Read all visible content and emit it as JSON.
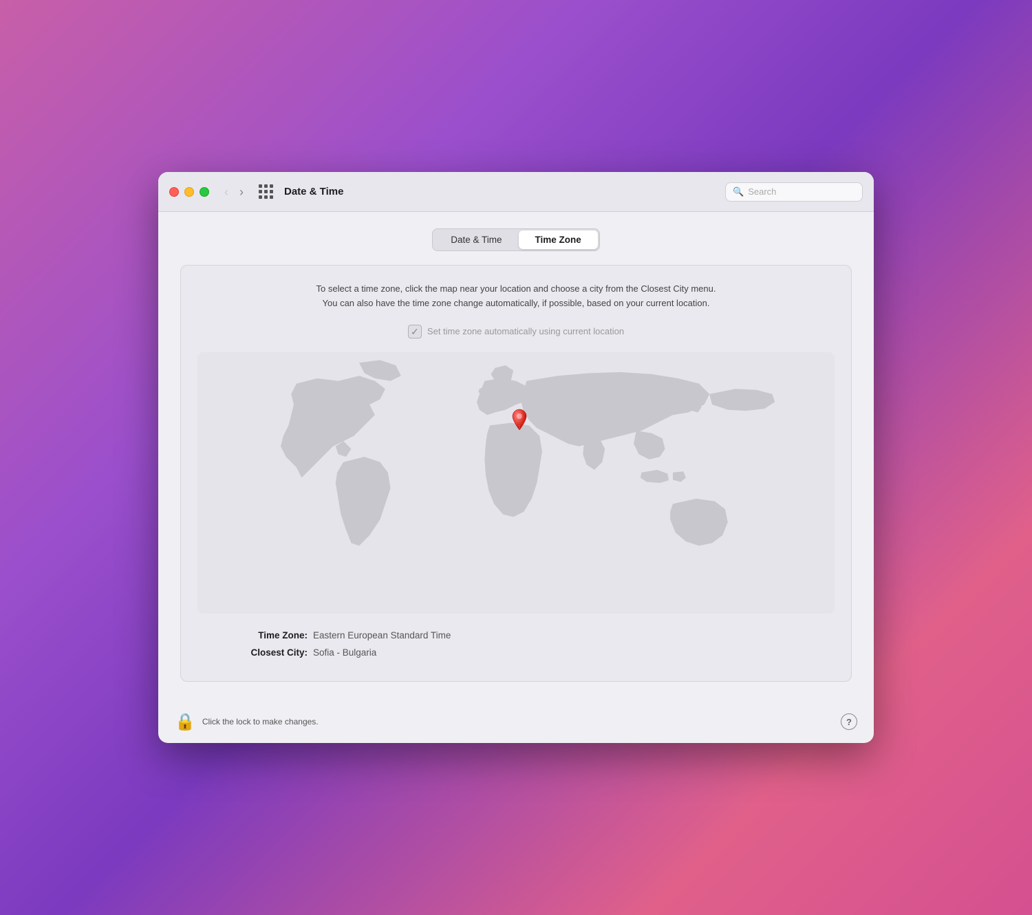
{
  "window": {
    "title": "Date & Time"
  },
  "traffic_lights": {
    "close": "close",
    "minimize": "minimize",
    "maximize": "maximize"
  },
  "nav": {
    "back_label": "‹",
    "forward_label": "›"
  },
  "search": {
    "placeholder": "Search"
  },
  "tabs": [
    {
      "id": "date-time",
      "label": "Date & Time",
      "active": false
    },
    {
      "id": "time-zone",
      "label": "Time Zone",
      "active": true
    }
  ],
  "description": {
    "line1": "To select a time zone, click the map near your location and choose a city from the Closest City menu.",
    "line2": "You can also have the time zone change automatically, if possible, based on your current location."
  },
  "auto_timezone": {
    "label": "Set time zone automatically using current location",
    "checked": true
  },
  "timezone_info": {
    "zone_label": "Time Zone:",
    "zone_value": "Eastern European Standard Time",
    "city_label": "Closest City:",
    "city_value": "Sofia - Bulgaria"
  },
  "bottom": {
    "lock_text": "Click the lock to make changes.",
    "help_label": "?"
  },
  "colors": {
    "active_tab_bg": "#ffffff",
    "panel_bg": "#eae9ef",
    "window_bg": "#f0eff4"
  }
}
